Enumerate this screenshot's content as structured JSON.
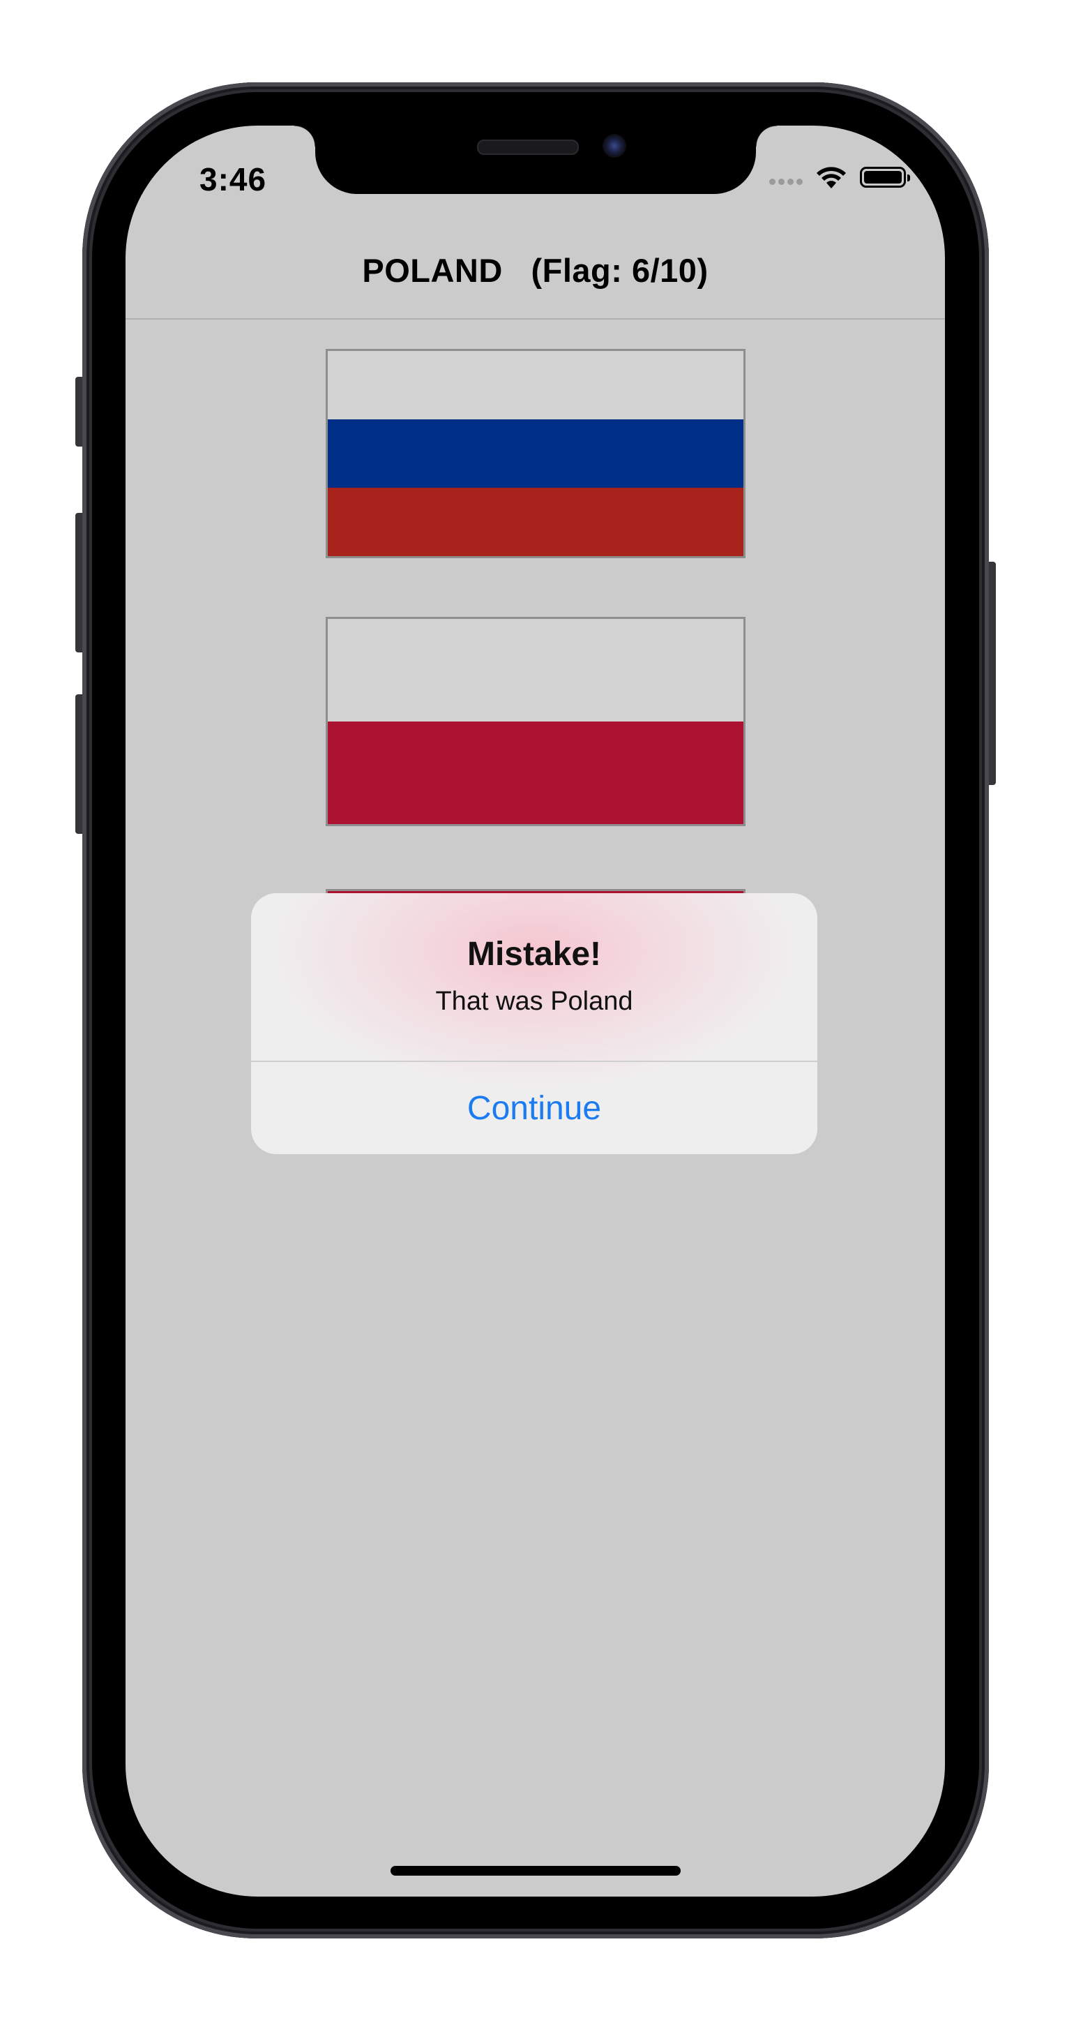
{
  "status_bar": {
    "time": "3:46",
    "wifi_icon": "wifi-icon",
    "battery_icon": "battery-icon"
  },
  "nav": {
    "title": "POLAND   (Flag: 6/10)"
  },
  "flags": [
    {
      "name": "russia-flag",
      "stripes": [
        "#d2d2d2",
        "#002f87",
        "#a8231c"
      ]
    },
    {
      "name": "poland-flag",
      "stripes": [
        "#d2d2d2",
        "#ad1233"
      ]
    },
    {
      "name": "partially-hidden-flag",
      "stripes": [
        "#ad1233"
      ]
    }
  ],
  "alert": {
    "title": "Mistake!",
    "message": "That was Poland",
    "button_label": "Continue"
  }
}
